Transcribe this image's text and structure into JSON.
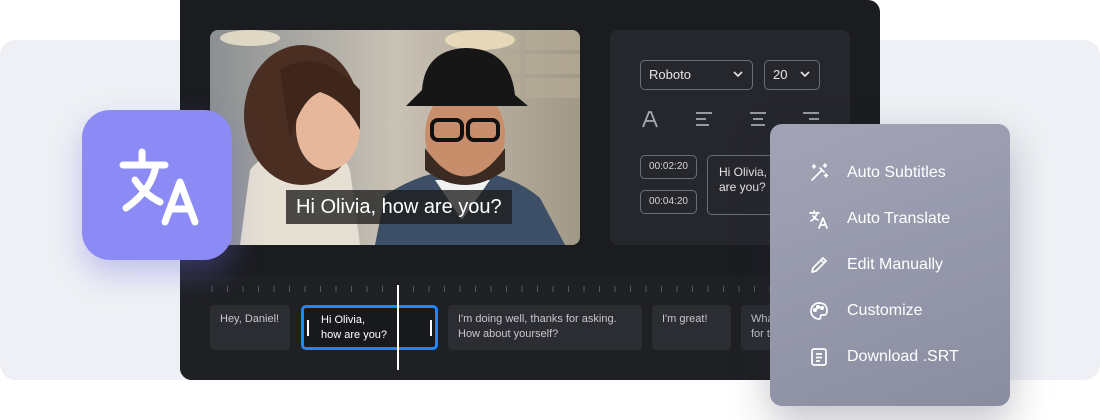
{
  "video": {
    "caption": "Hi Olivia, how are you?"
  },
  "style_panel": {
    "font_value": "Roboto",
    "size_value": "20",
    "timecode_start": "00:02:20",
    "timecode_end": "00:04:20",
    "caption_text_line1": "Hi Olivia,",
    "caption_text_line2": "are you?"
  },
  "timeline": {
    "clips": [
      {
        "line1": "Hey, Daniel!",
        "line2": ""
      },
      {
        "line1": "Hi Olivia,",
        "line2": "how are you?"
      },
      {
        "line1": "I'm doing well, thanks for asking.",
        "line2": "How about yourself?"
      },
      {
        "line1": "I'm great!",
        "line2": ""
      },
      {
        "line1": "Wha",
        "line2": "for t"
      }
    ]
  },
  "actions_menu": {
    "items": [
      {
        "label": "Auto Subtitles",
        "icon": "magic-wand-icon"
      },
      {
        "label": "Auto Translate",
        "icon": "translate-icon"
      },
      {
        "label": "Edit Manually",
        "icon": "pencil-icon"
      },
      {
        "label": "Customize",
        "icon": "palette-icon"
      },
      {
        "label": "Download .SRT",
        "icon": "document-icon"
      }
    ]
  },
  "colors": {
    "accent_purple": "#8c8bf5",
    "clip_selected_blue": "#1f86ff",
    "editor_bg": "#1b1c20"
  }
}
